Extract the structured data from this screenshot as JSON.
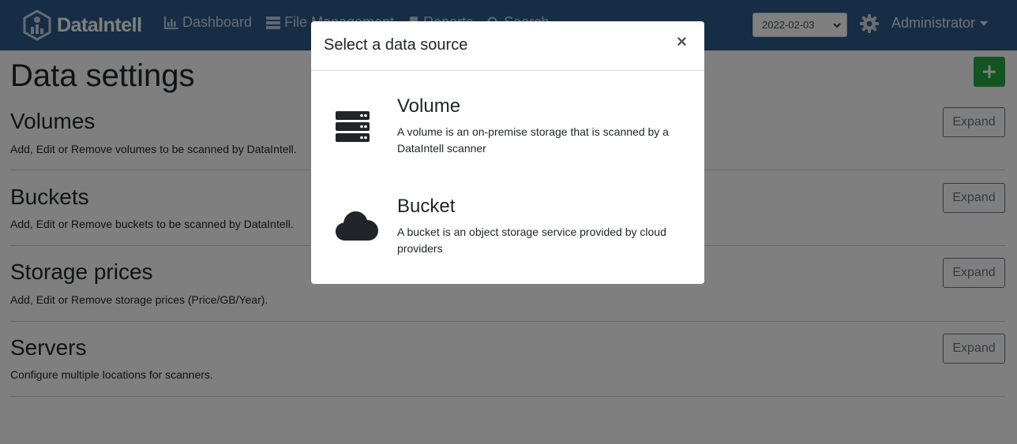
{
  "navbar": {
    "brand": "DataIntell",
    "links": [
      {
        "label": "Dashboard"
      },
      {
        "label": "File Management"
      },
      {
        "label": "Reports"
      },
      {
        "label": "Search"
      }
    ],
    "date": "2022-02-03",
    "user": "Administrator"
  },
  "page": {
    "title": "Data settings",
    "sections": [
      {
        "title": "Volumes",
        "description": "Add, Edit or Remove volumes to be scanned by DataIntell.",
        "button": "Expand"
      },
      {
        "title": "Buckets",
        "description": "Add, Edit or Remove buckets to be scanned by DataIntell.",
        "button": "Expand"
      },
      {
        "title": "Storage prices",
        "description": "Add, Edit or Remove storage prices (Price/GB/Year).",
        "button": "Expand"
      },
      {
        "title": "Servers",
        "description": "Configure multiple locations for scanners.",
        "button": "Expand"
      }
    ]
  },
  "modal": {
    "title": "Select a data source",
    "close": "×",
    "sources": [
      {
        "name": "Volume",
        "description": "A volume is an on-premise storage that is scanned by a DataIntell scanner",
        "icon": "server-icon"
      },
      {
        "name": "Bucket",
        "description": "A bucket is an object storage service provided by cloud providers",
        "icon": "cloud-icon"
      }
    ]
  },
  "colors": {
    "navbar": "#2e5b8c",
    "add_button": "#28a745",
    "backdrop": "rgba(0,0,0,0.5)"
  }
}
